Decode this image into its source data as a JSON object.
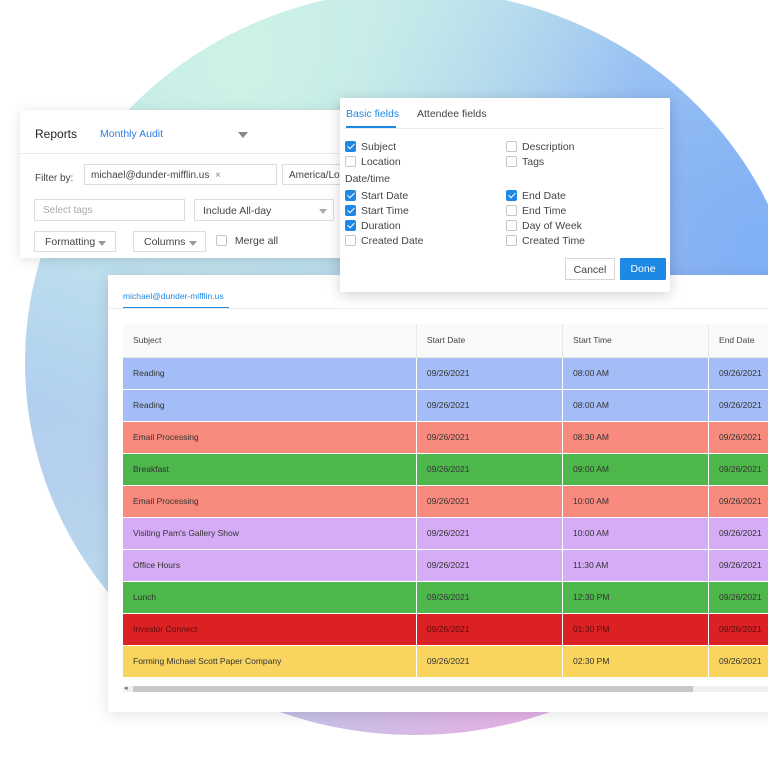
{
  "reports_panel": {
    "title": "Reports",
    "report_name": "Monthly Audit",
    "filter_label": "Filter by:",
    "email_chip": "michael@dunder-mifflin.us",
    "email_chip_remove": "×",
    "timezone": "America/Los_Angeles",
    "tags_placeholder": "Select tags",
    "include_allday": "Include All-day",
    "formatting": "Formatting",
    "columns": "Columns",
    "merge_all": "Merge all"
  },
  "fields_popover": {
    "tabs": [
      "Basic fields",
      "Attendee fields"
    ],
    "left": [
      {
        "label": "Subject",
        "checked": true
      },
      {
        "label": "Location",
        "checked": false
      }
    ],
    "right": [
      {
        "label": "Description",
        "checked": false
      },
      {
        "label": "Tags",
        "checked": false
      }
    ],
    "datetime_label": "Date/time",
    "dt_left": [
      {
        "label": "Start Date",
        "checked": true
      },
      {
        "label": "Start Time",
        "checked": true
      },
      {
        "label": "Duration",
        "checked": true
      },
      {
        "label": "Created Date",
        "checked": false
      }
    ],
    "dt_right": [
      {
        "label": "End Date",
        "checked": true
      },
      {
        "label": "End Time",
        "checked": false
      },
      {
        "label": "Day of Week",
        "checked": false
      },
      {
        "label": "Created Time",
        "checked": false
      }
    ],
    "cancel": "Cancel",
    "done": "Done"
  },
  "table_card": {
    "tab": "michael@dunder-mifflin.us",
    "headers": [
      "Subject",
      "Start Date",
      "Start Time",
      "End Date"
    ],
    "rows": [
      {
        "subject": "Reading",
        "start_date": "09/26/2021",
        "start_time": "08:00 AM",
        "end_date": "09/26/2021",
        "color": "#a4bdf7"
      },
      {
        "subject": "Reading",
        "start_date": "09/26/2021",
        "start_time": "08:00 AM",
        "end_date": "09/26/2021",
        "color": "#a4bdf7"
      },
      {
        "subject": "Email Processing",
        "start_date": "09/26/2021",
        "start_time": "08:30 AM",
        "end_date": "09/26/2021",
        "color": "#f88a7e"
      },
      {
        "subject": "Breakfast",
        "start_date": "09/26/2021",
        "start_time": "09:00 AM",
        "end_date": "09/26/2021",
        "color": "#4db74b"
      },
      {
        "subject": "Email Processing",
        "start_date": "09/26/2021",
        "start_time": "10:00 AM",
        "end_date": "09/26/2021",
        "color": "#f88a7e"
      },
      {
        "subject": "Visiting Pam's Gallery Show",
        "start_date": "09/26/2021",
        "start_time": "10:00 AM",
        "end_date": "09/26/2021",
        "color": "#d6acf7"
      },
      {
        "subject": "Office Hours",
        "start_date": "09/26/2021",
        "start_time": "11:30 AM",
        "end_date": "09/26/2021",
        "color": "#d6acf7"
      },
      {
        "subject": "Lunch",
        "start_date": "09/26/2021",
        "start_time": "12:30 PM",
        "end_date": "09/26/2021",
        "color": "#4db74b"
      },
      {
        "subject": "Investor Connect",
        "start_date": "09/26/2021",
        "start_time": "01:30 PM",
        "end_date": "09/26/2021",
        "color": "#db2124"
      },
      {
        "subject": "Forming Michael Scott Paper Company",
        "start_date": "09/26/2021",
        "start_time": "02:30 PM",
        "end_date": "09/26/2021",
        "color": "#f9d560"
      }
    ],
    "scroll_left": "◂"
  }
}
